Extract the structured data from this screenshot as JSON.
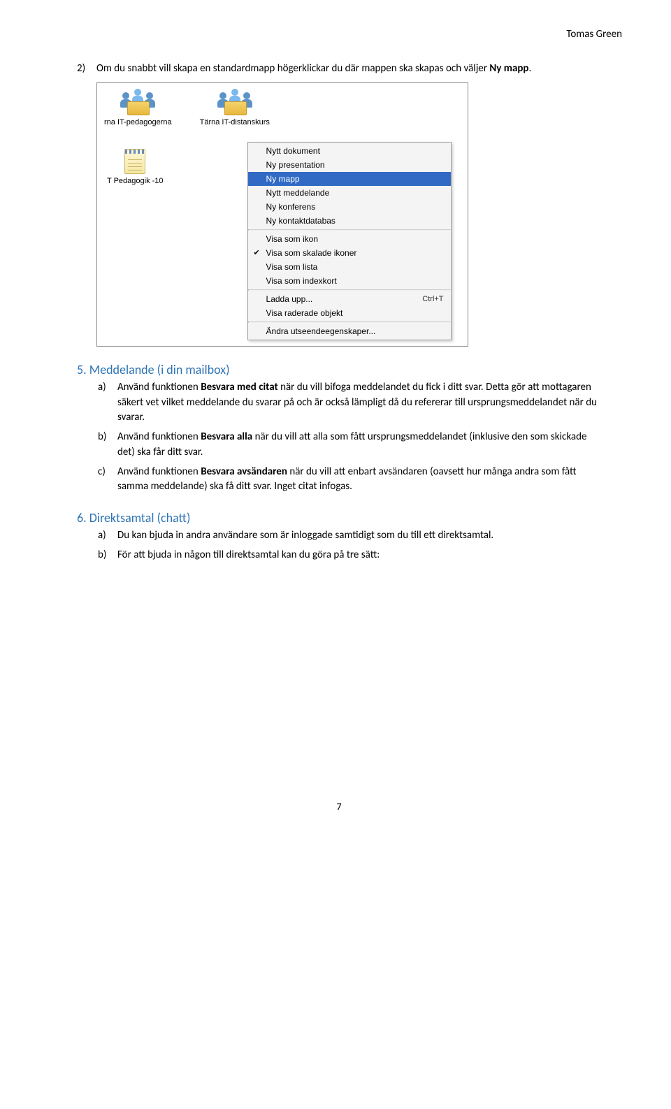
{
  "header": {
    "author": "Tomas Green"
  },
  "step2": {
    "marker": "2)",
    "text_before": "Om du snabbt vill skapa en standardmapp högerklickar du där mappen ska skapas och väljer ",
    "bold": "Ny mapp",
    "text_after": "."
  },
  "screenshot": {
    "icon1_label": "rna IT-pedagogerna",
    "icon2_label": "Tärna IT-distanskurs",
    "icon3_label": "T Pedagogik -10",
    "menu": {
      "group1": [
        "Nytt dokument",
        "Ny presentation",
        "Ny mapp",
        "Nytt meddelande",
        "Ny konferens",
        "Ny kontaktdatabas"
      ],
      "selected_index": 2,
      "group2": [
        "Visa som ikon",
        "Visa som skalade ikoner",
        "Visa som lista",
        "Visa som indexkort"
      ],
      "checked_index": 1,
      "group3": [
        {
          "label": "Ladda upp...",
          "shortcut": "Ctrl+T"
        },
        {
          "label": "Visa raderade objekt",
          "shortcut": ""
        }
      ],
      "group4": [
        "Ändra utseendeegenskaper..."
      ]
    }
  },
  "section5": {
    "heading": "5.  Meddelande (i din mailbox)",
    "a": {
      "marker": "a)",
      "t1": "Använd funktionen ",
      "b1": "Besvara med citat",
      "t2": " när du vill bifoga meddelandet du fick i ditt svar. Detta gör att mottagaren säkert vet vilket meddelande du svarar på och är också lämpligt då du refererar till ursprungsmeddelandet när du svarar."
    },
    "b": {
      "marker": "b)",
      "t1": "Använd funktionen ",
      "b1": "Besvara alla",
      "t2": " när du vill att alla som fått ursprungsmeddelandet (inklusive den som skickade det) ska får ditt svar."
    },
    "c": {
      "marker": "c)",
      "t1": "Använd funktionen ",
      "b1": "Besvara avsändaren",
      "t2": " när du vill att enbart avsändaren (oavsett hur många andra som fått samma meddelande) ska få ditt svar. Inget citat infogas."
    }
  },
  "section6": {
    "heading": "6.  Direktsamtal (chatt)",
    "a": {
      "marker": "a)",
      "text": "Du kan bjuda in andra användare som är inloggade samtidigt som du till ett direktsamtal."
    },
    "b": {
      "marker": "b)",
      "text": "För att bjuda in någon till direktsamtal kan du göra på tre sätt:"
    }
  },
  "page_number": "7"
}
